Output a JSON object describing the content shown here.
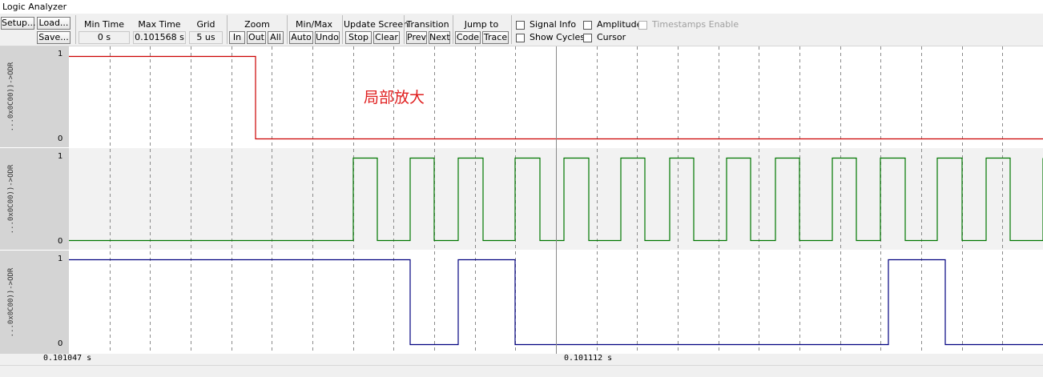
{
  "window": {
    "title": "Logic Analyzer"
  },
  "toolbar": {
    "setup": "Setup...",
    "load": "Load...",
    "save": "Save...",
    "min_time_label": "Min Time",
    "min_time_value": "0 s",
    "max_time_label": "Max Time",
    "max_time_value": "0.101568 s",
    "grid_label": "Grid",
    "grid_value": "5 us",
    "zoom_label": "Zoom",
    "zoom_in": "In",
    "zoom_out": "Out",
    "zoom_all": "All",
    "minmax_label": "Min/Max",
    "minmax_auto": "Auto",
    "minmax_undo": "Undo",
    "update_label": "Update Screen",
    "update_stop": "Stop",
    "update_clear": "Clear",
    "transition_label": "Transition",
    "transition_prev": "Prev",
    "transition_next": "Next",
    "jump_label": "Jump to",
    "jump_code": "Code",
    "jump_trace": "Trace",
    "signal_info": "Signal Info",
    "show_cycles": "Show Cycles",
    "amplitude": "Amplitude",
    "cursor": "Cursor",
    "timestamps": "Timestamps Enable"
  },
  "signals": [
    {
      "label": "...0x0C00))->ODR",
      "high": "1",
      "low": "0",
      "color": "#cc0000"
    },
    {
      "label": "...0x0C00))->ODR",
      "high": "1",
      "low": "0",
      "color": "#007700"
    },
    {
      "label": "...0x0C00))->ODR",
      "high": "1",
      "low": "0",
      "color": "#000080"
    }
  ],
  "chart_data": {
    "type": "line",
    "x_unit": "s",
    "time_labels": [
      "0.101047 s",
      "0.101112 s"
    ],
    "series": [
      {
        "transitions_us": [
          0,
          23
        ],
        "levels": [
          1,
          0
        ]
      },
      {
        "transitions_us": [
          0,
          35,
          38,
          42,
          45,
          48,
          51,
          55,
          58,
          61,
          64,
          68,
          71,
          74,
          77,
          81,
          84,
          87,
          90,
          94,
          97,
          100,
          103,
          107,
          110,
          113,
          116,
          120
        ],
        "levels": [
          0,
          1,
          0,
          1,
          0,
          1,
          0,
          1,
          0,
          1,
          0,
          1,
          0,
          1,
          0,
          1,
          0,
          1,
          0,
          1,
          0,
          1,
          0,
          1,
          0,
          1,
          0,
          1
        ]
      },
      {
        "transitions_us": [
          0,
          42,
          48,
          55,
          101,
          108
        ],
        "levels": [
          1,
          0,
          1,
          0,
          1,
          0
        ]
      }
    ],
    "span_us": 120,
    "grid_us": 5,
    "cursor_us": 60,
    "annotation": "局部放大"
  }
}
